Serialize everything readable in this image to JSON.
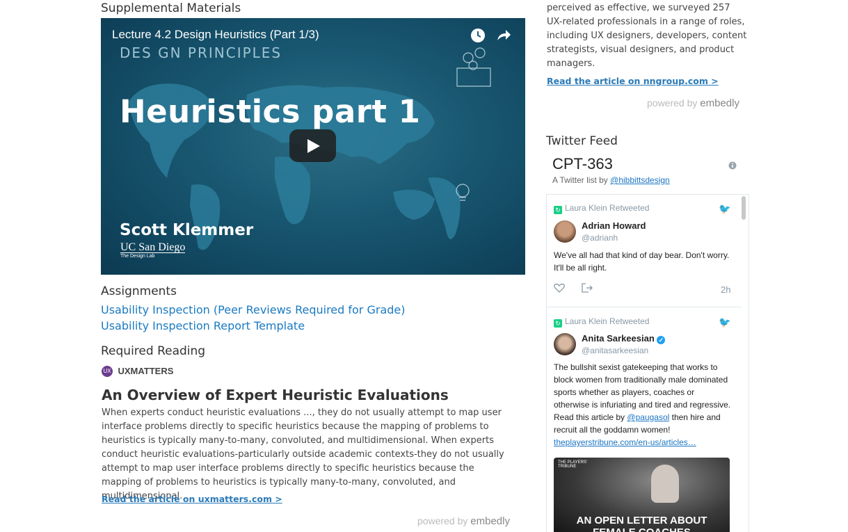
{
  "left": {
    "supplemental_heading": "Supplemental Materials",
    "video": {
      "title": "Lecture 4.2 Design Heuristics (Part 1/3)",
      "kicker": "DES GN PRINCIPLES",
      "big_title": "Heuristics part 1",
      "speaker": "Scott Klemmer",
      "org": "UC San Diego",
      "org_sub": "The Design Lab"
    },
    "assignments_heading": "Assignments",
    "assignments": [
      {
        "label": "Usability Inspection (Peer Reviews Required for Grade)"
      },
      {
        "label": "Usability Inspection Report Template"
      }
    ],
    "required_heading": "Required Reading",
    "source_logo_badge": "UX",
    "source_logo_text": "UXMATTERS",
    "article_title": "An Overview of Expert Heuristic Evaluations",
    "article_body": "When experts conduct heuristic evaluations ..., they do not usually attempt to map user interface problems directly to specific heuristics because the mapping of problems to heuristics is typically many-to-many, convoluted, and multidimensional. When experts conduct heuristic evaluations-particularly outside academic contexts-they do not usually attempt to map user interface problems directly to specific heuristics because the mapping of problems to heuristics is typically many-to-many, convoluted, and multidimensional.",
    "read_link": "Read the article on uxmatters.com >",
    "powered_prefix": "powered by",
    "powered_brand": "embedly"
  },
  "right": {
    "excerpt": "perceived as effective, we surveyed 257 UX-related professionals in a range of roles, including UX designers, developers, content strategists, visual designers, and product managers.",
    "read_link": "Read the article on nngroup.com >",
    "powered_prefix": "powered by",
    "powered_brand": "embedly",
    "twitter_heading": "Twitter Feed",
    "list_title": "CPT-363",
    "list_by_prefix": "A Twitter list by",
    "list_by_user": "@hibbittsdesign",
    "tweets": [
      {
        "retweeted_by": "Laura Klein Retweeted",
        "name": "Adrian Howard",
        "handle": "@adrianh",
        "text": "We've all had that kind of day bear. Don't worry. It'll be all right.",
        "time": "2h"
      },
      {
        "retweeted_by": "Laura Klein Retweeted",
        "name": "Anita Sarkeesian",
        "handle": "@anitasarkeesian",
        "text_a": "The bullshit sexist gatekeeping that works to block women from traditionally male dominated sports whether as players, coaches or otherwise is infuriating and tired and regressive. Read this article by ",
        "mention": "@paugasol",
        "text_b": " then hire and recruit all the goddamn women!",
        "link": "theplayerstribune.com/en-us/articles…",
        "card_brand": "THE PLAYERS' TRIBUNE",
        "card_headline": "AN OPEN LETTER ABOUT FEMALE COACHES"
      }
    ]
  }
}
